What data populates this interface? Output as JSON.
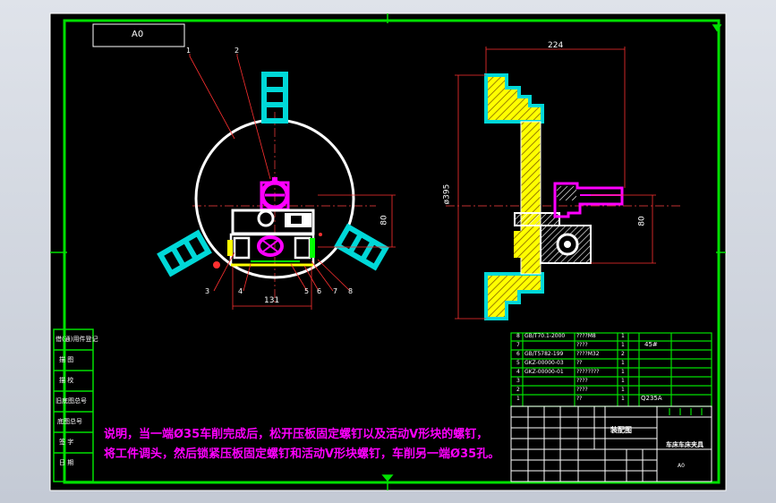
{
  "sheet": {
    "size_label": "A0"
  },
  "front_view": {
    "dim_width": "131",
    "dim_height": "80",
    "leaders": [
      "1",
      "2",
      "3",
      "4",
      "5",
      "6",
      "7",
      "8"
    ]
  },
  "side_view": {
    "dim_top": "224",
    "dim_diameter": "ø395",
    "dim_height": "80"
  },
  "note": {
    "line1": "说明，当一端Ø35车削完成后，松开压板固定螺钉以及活动V形块的螺钉，",
    "line2": "将工件调头，然后锁紧压板固定螺钉和活动V形块螺钉，车削另一端Ø35孔。"
  },
  "bom_rows": [
    {
      "no": "8",
      "code": "GB/T70.1-2000",
      "name": "????M8",
      "qty": "1",
      "mat": ""
    },
    {
      "no": "7",
      "code": "",
      "name": "????",
      "qty": "1",
      "mat": "45#"
    },
    {
      "no": "6",
      "code": "GB/T5782-199",
      "name": "????M32",
      "qty": "2",
      "mat": ""
    },
    {
      "no": "5",
      "code": "GKZ-00000-03",
      "name": "??",
      "qty": "1",
      "mat": ""
    },
    {
      "no": "4",
      "code": "GKZ-00000-01",
      "name": "????????",
      "qty": "1",
      "mat": ""
    },
    {
      "no": "3",
      "code": "",
      "name": "????",
      "qty": "1",
      "mat": ""
    },
    {
      "no": "2",
      "code": "",
      "name": "????",
      "qty": "1",
      "mat": ""
    },
    {
      "no": "1",
      "code": "",
      "name": "??",
      "qty": "1",
      "mat": "Q235A"
    }
  ],
  "title_block": {
    "label_assembly": "装配图",
    "drawing_name": "车床车床夹具",
    "sheet_size": "A0"
  },
  "side_stamps": [
    "借(通)用件登记",
    "描  图",
    "描  校",
    "旧底图总号",
    "底图总号",
    "签  字",
    "日  期"
  ]
}
